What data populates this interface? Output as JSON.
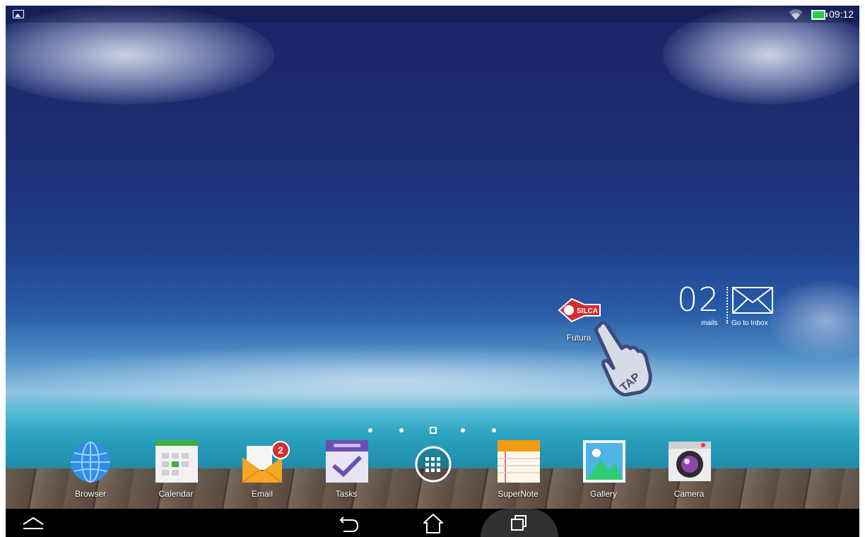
{
  "status_bar": {
    "time": "09:12",
    "icons": [
      "gallery-notification-icon",
      "wifi-icon",
      "battery-icon"
    ],
    "battery_color": "#2ecc40"
  },
  "home": {
    "shortcut": {
      "label": "Futura",
      "icon": "silca-logo-icon",
      "brand_color": "#d32f2f",
      "logo_text": "SILCA"
    },
    "tap_hint": {
      "text": "TAP",
      "icon": "tap-hand-icon"
    },
    "mail_widget": {
      "count": "02",
      "count_label": "mails",
      "action_label": "Go to Inbox",
      "icon": "envelope-icon"
    },
    "page_indicator": {
      "pages": 5,
      "current": 3
    }
  },
  "dock": {
    "apps": [
      {
        "label": "Browser",
        "icon": "globe-icon"
      },
      {
        "label": "Calendar",
        "icon": "calendar-icon"
      },
      {
        "label": "Email",
        "icon": "email-icon",
        "badge": "2"
      },
      {
        "label": "Tasks",
        "icon": "tasks-icon"
      },
      {
        "label": "",
        "icon": "all-apps-icon"
      },
      {
        "label": "SuperNote",
        "icon": "notebook-icon"
      },
      {
        "label": "Gallery",
        "icon": "gallery-icon"
      },
      {
        "label": "Camera",
        "icon": "camera-icon"
      }
    ]
  },
  "nav_bar": {
    "buttons": [
      "menu-up-icon",
      "back-icon",
      "home-icon",
      "recents-icon"
    ]
  }
}
